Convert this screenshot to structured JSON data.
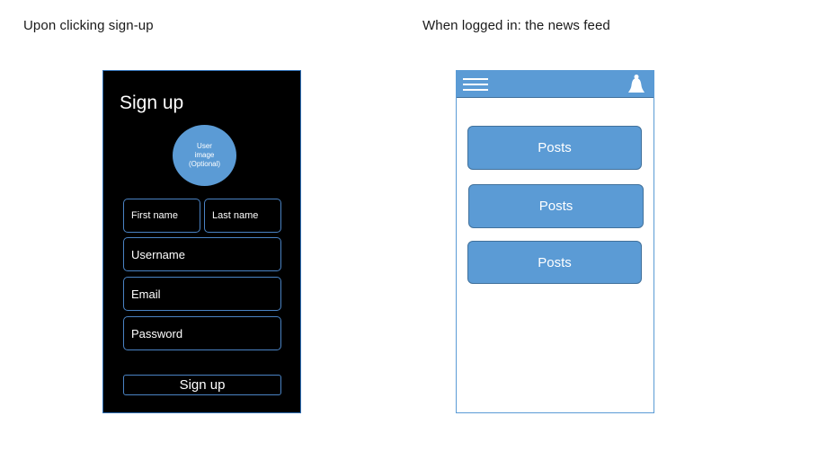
{
  "captions": {
    "left": "Upon clicking sign-up",
    "right": "When logged in: the news feed"
  },
  "signup": {
    "title": "Sign up",
    "avatar_lines": [
      "User",
      "image",
      "(Optional)"
    ],
    "fields": {
      "first_name": "First name",
      "last_name": "Last name",
      "username": "Username",
      "email": "Email",
      "password": "Password"
    },
    "button_label": "Sign up"
  },
  "feed": {
    "header_icons": [
      "menu-icon",
      "bell-icon"
    ],
    "posts": [
      "Posts",
      "Posts",
      "Posts"
    ]
  },
  "colors": {
    "accent": "#5b9bd5",
    "accent_border": "#41719c",
    "signup_background": "#000000",
    "text_light": "#ffffff"
  }
}
